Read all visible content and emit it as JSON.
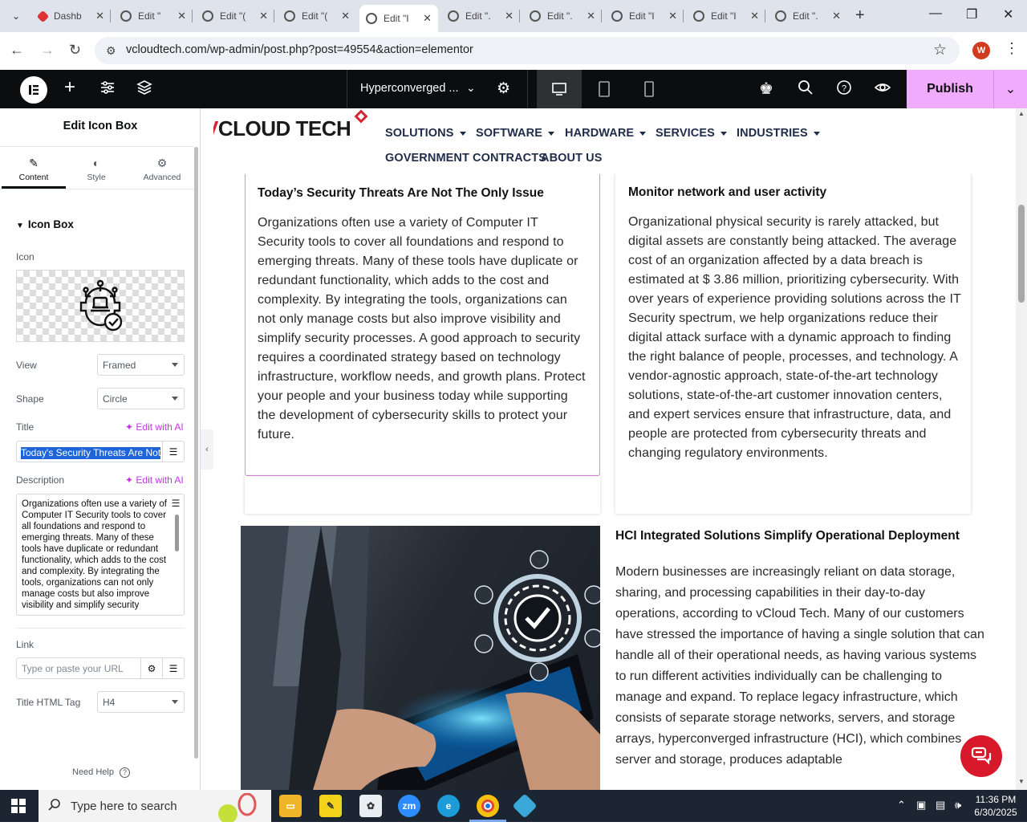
{
  "browser": {
    "tabs": [
      {
        "label": "Dashb",
        "favicon": "elementor-diamond-icon"
      },
      {
        "label": "Edit \""
      },
      {
        "label": "Edit \"("
      },
      {
        "label": "Edit \"("
      },
      {
        "label": "Edit \"I",
        "active": true
      },
      {
        "label": "Edit \"."
      },
      {
        "label": "Edit \"."
      },
      {
        "label": "Edit \"I"
      },
      {
        "label": "Edit \"I"
      },
      {
        "label": "Edit \"."
      }
    ],
    "url": "vcloudtech.com/wp-admin/post.php?post=49554&action=elementor",
    "profile_initial": "W"
  },
  "editor_top": {
    "page_name": "Hyperconverged ...",
    "publish_label": "Publish",
    "accent": "#f0abfc"
  },
  "panel": {
    "title": "Edit Icon Box",
    "tabs": [
      "Content",
      "Style",
      "Advanced"
    ],
    "section": "Icon Box",
    "icon_label": "Icon",
    "view_label": "View",
    "view_value": "Framed",
    "shape_label": "Shape",
    "shape_value": "Circle",
    "title_label": "Title",
    "edit_ai": "Edit with AI",
    "title_value": "Today's Security Threats Are Not",
    "description_label": "Description",
    "description_value": "Organizations often use a variety of Computer IT Security tools to cover all foundations and respond to emerging threats. Many of these tools have duplicate or redundant functionality, which adds to the cost and complexity. By integrating the tools, organizations can not only manage costs but also improve visibility and simplify security",
    "link_label": "Link",
    "link_placeholder": "Type or paste your URL",
    "tag_label": "Title HTML Tag",
    "tag_value": "H4",
    "help": "Need Help"
  },
  "site": {
    "logo_v": "V",
    "logo_rest": "CLOUD TECH",
    "menu": [
      "SOLUTIONS",
      "SOFTWARE",
      "HARDWARE",
      "SERVICES",
      "INDUSTRIES"
    ],
    "menu2": [
      "GOVERNMENT CONTRACTS",
      "ABOUT US"
    ],
    "card1_title": "Today’s Security Threats Are Not The Only Issue",
    "card1_text": "Organizations often use a variety of Computer IT Security tools to cover all foundations and respond to emerging threats. Many of these tools have duplicate or redundant functionality, which adds to the cost and complexity. By integrating the tools, organizations can not only manage costs but also improve visibility and simplify security processes. A good approach to security requires a coordinated strategy based on technology infrastructure, workflow needs, and growth plans. Protect your people and your business today while supporting the development of cybersecurity skills to protect your future.",
    "card2_title": "Monitor network and user activity",
    "card2_text": "Organizational physical security is rarely attacked, but digital assets are constantly being attacked. The average cost of an organization affected by a data breach is estimated at $ 3.86 million, prioritizing cybersecurity. With over years of experience providing solutions across the IT Security spectrum, we help organizations reduce their digital attack surface with a dynamic approach to finding the right balance of people, processes, and technology. A vendor-agnostic approach, state-of-the-art technology solutions, state-of-the-art customer innovation centers, and expert services ensure that infrastructure, data, and people are protected from cybersecurity threats and changing regulatory environments.",
    "hci_title": "HCI Integrated Solutions Simplify Operational Deployment",
    "hci_text": "Modern businesses are increasingly reliant on data storage, sharing, and processing capabilities in their day-to-day operations, according to vCloud Tech. Many of our customers have stressed the importance of having a single solution that can handle all of their operational needs, as having various systems to run different activities individually can be challenging to manage and expand. To replace legacy infrastructure, which consists of separate storage networks, servers, and storage arrays, hyperconverged infrastructure (HCI), which combines server and storage, produces adaptable"
  },
  "taskbar": {
    "search_placeholder": "Type here to search",
    "time": "11:36 PM",
    "date": "6/30/2025",
    "apps": [
      "file-explorer-icon",
      "sticky-notes-icon",
      "paint-icon",
      "zoom-icon",
      "edge-icon",
      "chrome-icon",
      "app-icon"
    ]
  }
}
